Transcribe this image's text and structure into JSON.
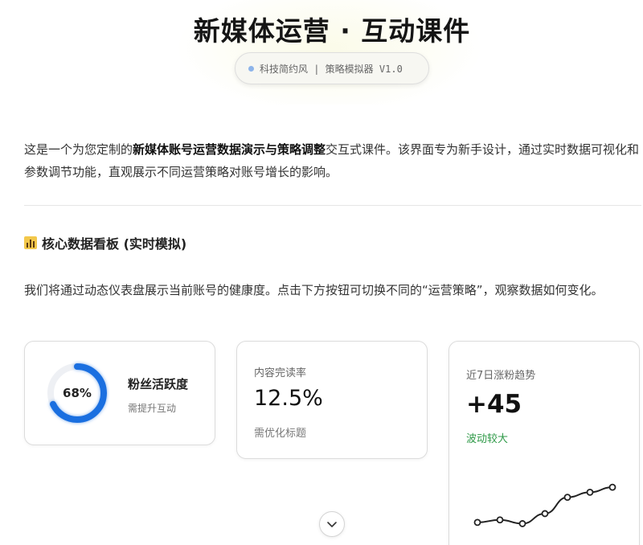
{
  "header": {
    "title": "新媒体运营 · 互动课件",
    "badge": "科技简约风 | 策略模拟器 V1.0"
  },
  "intro": {
    "part1": "这是一个为您定制的",
    "bold": "新媒体账号运营数据演示与策略调整",
    "part2": "交互式课件。该界面专为新手设计，通过实时数据可视化和参数调节功能，直观展示不同运营策略对账号增长的影响。"
  },
  "section": {
    "icon": "bar-chart-icon",
    "title": "核心数据看板 (实时模拟)",
    "description": "我们将通过动态仪表盘展示当前账号的健康度。点击下方按钮可切换不同的“运营策略”，观察数据如何变化。"
  },
  "cards": {
    "fans": {
      "gauge_text": "68%",
      "gauge_value": 68,
      "label": "粉丝活跃度",
      "sub": "需提升互动",
      "color": "#1a6fe0"
    },
    "completion": {
      "label": "内容完读率",
      "value": "12.5%",
      "sub": "需优化标题"
    },
    "trend": {
      "label": "近7日涨粉趋势",
      "value": "+45",
      "sub": "波动较大",
      "sub_color": "#2f9a48",
      "points": [
        12,
        14,
        11,
        19,
        32,
        36,
        40
      ]
    }
  },
  "scroll_button": {
    "icon": "chevron-down-icon"
  }
}
